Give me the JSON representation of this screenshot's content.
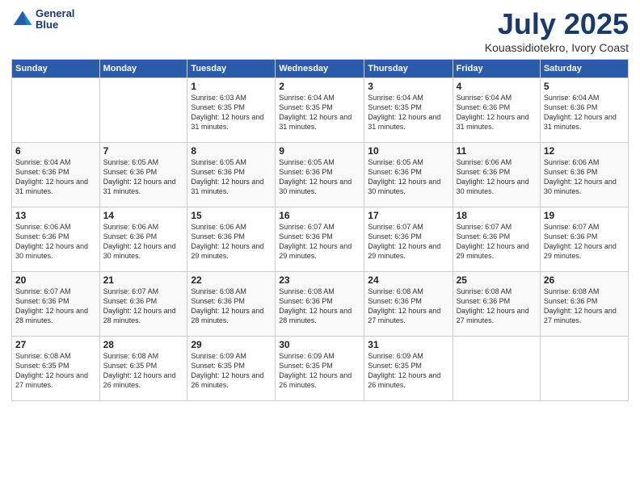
{
  "header": {
    "logo": {
      "line1": "General",
      "line2": "Blue"
    },
    "title": "July 2025",
    "subtitle": "Kouassidiotekro, Ivory Coast"
  },
  "calendar": {
    "days_of_week": [
      "Sunday",
      "Monday",
      "Tuesday",
      "Wednesday",
      "Thursday",
      "Friday",
      "Saturday"
    ],
    "weeks": [
      [
        {
          "day": "",
          "info": ""
        },
        {
          "day": "",
          "info": ""
        },
        {
          "day": "1",
          "info": "Sunrise: 6:03 AM\nSunset: 6:35 PM\nDaylight: 12 hours and 31 minutes."
        },
        {
          "day": "2",
          "info": "Sunrise: 6:04 AM\nSunset: 6:35 PM\nDaylight: 12 hours and 31 minutes."
        },
        {
          "day": "3",
          "info": "Sunrise: 6:04 AM\nSunset: 6:35 PM\nDaylight: 12 hours and 31 minutes."
        },
        {
          "day": "4",
          "info": "Sunrise: 6:04 AM\nSunset: 6:36 PM\nDaylight: 12 hours and 31 minutes."
        },
        {
          "day": "5",
          "info": "Sunrise: 6:04 AM\nSunset: 6:36 PM\nDaylight: 12 hours and 31 minutes."
        }
      ],
      [
        {
          "day": "6",
          "info": "Sunrise: 6:04 AM\nSunset: 6:36 PM\nDaylight: 12 hours and 31 minutes."
        },
        {
          "day": "7",
          "info": "Sunrise: 6:05 AM\nSunset: 6:36 PM\nDaylight: 12 hours and 31 minutes."
        },
        {
          "day": "8",
          "info": "Sunrise: 6:05 AM\nSunset: 6:36 PM\nDaylight: 12 hours and 31 minutes."
        },
        {
          "day": "9",
          "info": "Sunrise: 6:05 AM\nSunset: 6:36 PM\nDaylight: 12 hours and 30 minutes."
        },
        {
          "day": "10",
          "info": "Sunrise: 6:05 AM\nSunset: 6:36 PM\nDaylight: 12 hours and 30 minutes."
        },
        {
          "day": "11",
          "info": "Sunrise: 6:06 AM\nSunset: 6:36 PM\nDaylight: 12 hours and 30 minutes."
        },
        {
          "day": "12",
          "info": "Sunrise: 6:06 AM\nSunset: 6:36 PM\nDaylight: 12 hours and 30 minutes."
        }
      ],
      [
        {
          "day": "13",
          "info": "Sunrise: 6:06 AM\nSunset: 6:36 PM\nDaylight: 12 hours and 30 minutes."
        },
        {
          "day": "14",
          "info": "Sunrise: 6:06 AM\nSunset: 6:36 PM\nDaylight: 12 hours and 30 minutes."
        },
        {
          "day": "15",
          "info": "Sunrise: 6:06 AM\nSunset: 6:36 PM\nDaylight: 12 hours and 29 minutes."
        },
        {
          "day": "16",
          "info": "Sunrise: 6:07 AM\nSunset: 6:36 PM\nDaylight: 12 hours and 29 minutes."
        },
        {
          "day": "17",
          "info": "Sunrise: 6:07 AM\nSunset: 6:36 PM\nDaylight: 12 hours and 29 minutes."
        },
        {
          "day": "18",
          "info": "Sunrise: 6:07 AM\nSunset: 6:36 PM\nDaylight: 12 hours and 29 minutes."
        },
        {
          "day": "19",
          "info": "Sunrise: 6:07 AM\nSunset: 6:36 PM\nDaylight: 12 hours and 29 minutes."
        }
      ],
      [
        {
          "day": "20",
          "info": "Sunrise: 6:07 AM\nSunset: 6:36 PM\nDaylight: 12 hours and 28 minutes."
        },
        {
          "day": "21",
          "info": "Sunrise: 6:07 AM\nSunset: 6:36 PM\nDaylight: 12 hours and 28 minutes."
        },
        {
          "day": "22",
          "info": "Sunrise: 6:08 AM\nSunset: 6:36 PM\nDaylight: 12 hours and 28 minutes."
        },
        {
          "day": "23",
          "info": "Sunrise: 6:08 AM\nSunset: 6:36 PM\nDaylight: 12 hours and 28 minutes."
        },
        {
          "day": "24",
          "info": "Sunrise: 6:08 AM\nSunset: 6:36 PM\nDaylight: 12 hours and 27 minutes."
        },
        {
          "day": "25",
          "info": "Sunrise: 6:08 AM\nSunset: 6:36 PM\nDaylight: 12 hours and 27 minutes."
        },
        {
          "day": "26",
          "info": "Sunrise: 6:08 AM\nSunset: 6:36 PM\nDaylight: 12 hours and 27 minutes."
        }
      ],
      [
        {
          "day": "27",
          "info": "Sunrise: 6:08 AM\nSunset: 6:35 PM\nDaylight: 12 hours and 27 minutes."
        },
        {
          "day": "28",
          "info": "Sunrise: 6:08 AM\nSunset: 6:35 PM\nDaylight: 12 hours and 26 minutes."
        },
        {
          "day": "29",
          "info": "Sunrise: 6:09 AM\nSunset: 6:35 PM\nDaylight: 12 hours and 26 minutes."
        },
        {
          "day": "30",
          "info": "Sunrise: 6:09 AM\nSunset: 6:35 PM\nDaylight: 12 hours and 26 minutes."
        },
        {
          "day": "31",
          "info": "Sunrise: 6:09 AM\nSunset: 6:35 PM\nDaylight: 12 hours and 26 minutes."
        },
        {
          "day": "",
          "info": ""
        },
        {
          "day": "",
          "info": ""
        }
      ]
    ]
  }
}
